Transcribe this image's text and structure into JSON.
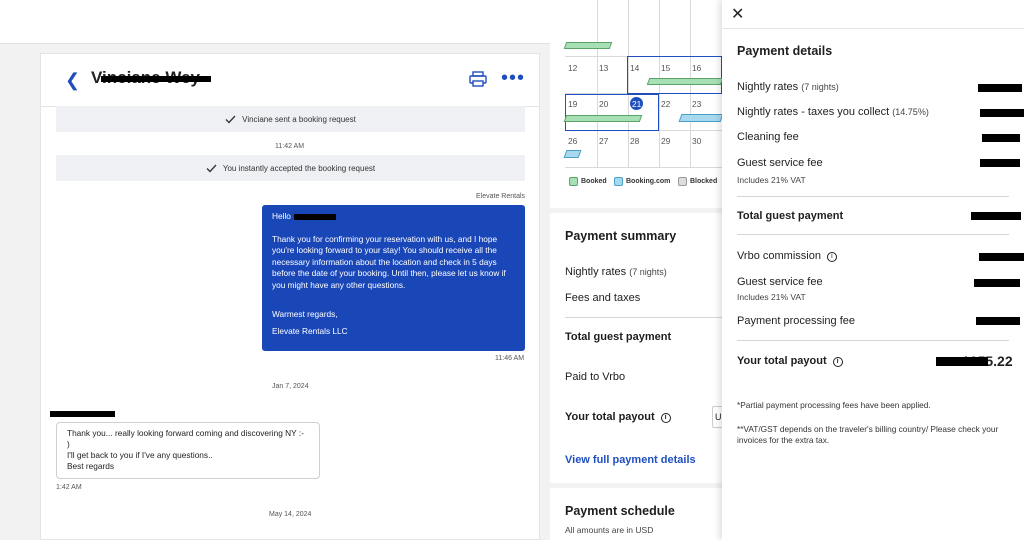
{
  "conversation": {
    "header": {
      "guest_name": "Vinciane Wey"
    },
    "events": [
      {
        "text": "Vinciane sent a booking request"
      },
      {
        "text": "You instantly accepted the booking request"
      }
    ],
    "times": {
      "t1": "11:42 AM",
      "t2": "11:46 AM",
      "t3": "1:42 AM"
    },
    "sender_company": "Elevate Rentals",
    "outgoing_message": {
      "greeting": "Hello",
      "body": "Thank you for confirming your reservation with us, and I hope you're looking forward to your stay!  You should receive all the necessary information about the location and check in 5 days before the date of your booking. Until then, please let us know if you might have any other questions.",
      "signoff": "Warmest regards,",
      "signature": "Elevate Rentals LLC"
    },
    "date_dividers": {
      "d1": "Jan 7, 2024",
      "d2": "May 14, 2024"
    },
    "incoming_message": {
      "line1": "Thank you... really looking forward coming and discovering NY :-",
      "line2": ")",
      "line3": "I'll get back to you if I've any questions..",
      "line4": "Best regards"
    }
  },
  "calendar": {
    "dates": [
      "12",
      "13",
      "14",
      "15",
      "16",
      "19",
      "20",
      "21",
      "22",
      "23",
      "26",
      "27",
      "28",
      "29",
      "30"
    ],
    "legend": {
      "booked": "Booked",
      "booking_com": "Booking.com",
      "blocked": "Blocked"
    },
    "colors": {
      "booked": "#a8e0b5",
      "booking_com": "#a7d8ee",
      "blocked": "#dddddd",
      "selected": "#1f4fbf"
    }
  },
  "summary": {
    "title": "Payment summary",
    "nightly": "Nightly rates",
    "nightly_sub": "(7 nights)",
    "fees": "Fees and taxes",
    "total_guest": "Total guest payment",
    "paid_to": "Paid to Vrbo",
    "payout": "Your total payout",
    "payout_partial": "U",
    "view_full": "View full payment details"
  },
  "schedule": {
    "title": "Payment schedule",
    "note": "All amounts are in USD"
  },
  "drawer": {
    "title": "Payment details",
    "nightly": "Nightly rates",
    "nightly_sub": "(7 nights)",
    "nightly_minus": "Nightly rates - taxes you collect",
    "nightly_minus_sub": "(14.75%)",
    "cleaning": "Cleaning fee",
    "guest_service": "Guest service fee",
    "vat": "Includes 21% VAT",
    "total_guest": "Total guest payment",
    "vrbo_commission": "Vrbo commission",
    "guest_service2": "Guest service fee",
    "vat2": "Includes 21% VAT",
    "processing": "Payment processing fee",
    "payout": "Your total payout",
    "payout_amount": "1055.22",
    "note1": "*Partial payment processing fees have been applied.",
    "note2": "**VAT/GST depends on the traveler's billing country/ Please check your invoices for the extra tax."
  }
}
